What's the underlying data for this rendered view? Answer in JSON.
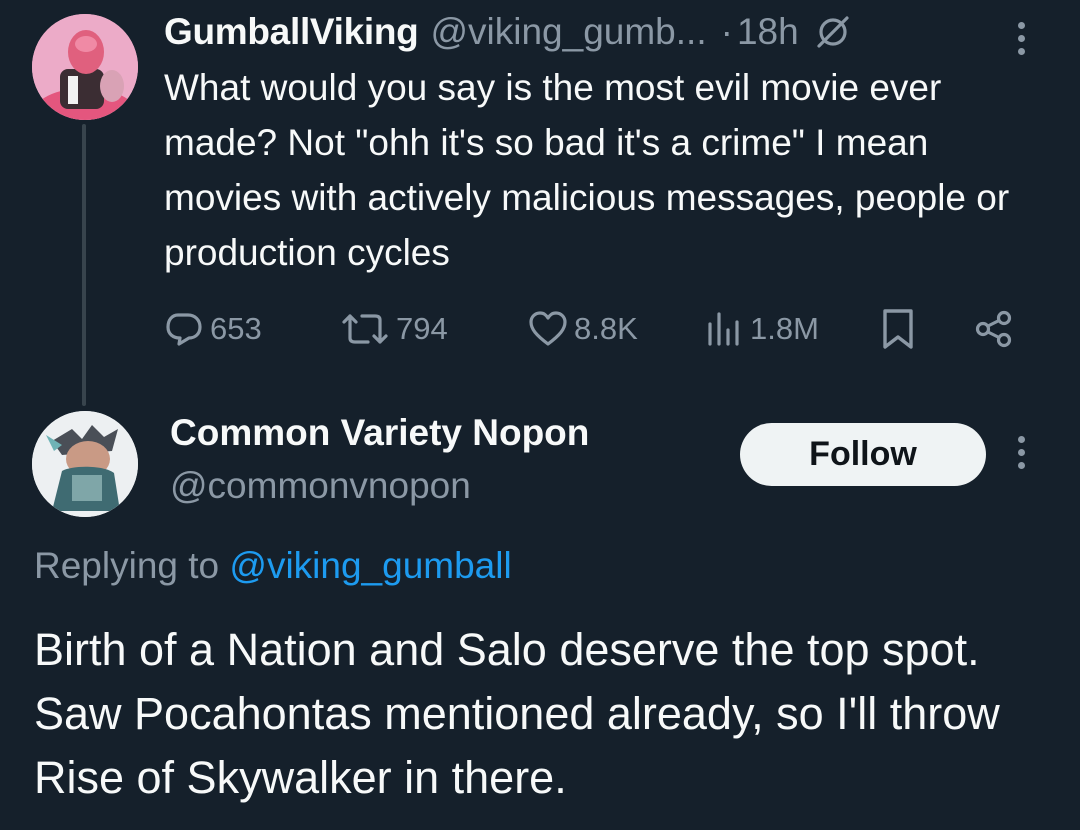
{
  "parent_tweet": {
    "display_name": "GumballViking",
    "handle": "@viking_gumb...",
    "separator": "·",
    "time": "18h",
    "text": "What would you say is the most evil movie ever made? Not \"ohh it's so bad it's a crime\" I mean movies with actively malicious messages, people or production cycles",
    "actions": {
      "replies": "653",
      "reposts": "794",
      "likes": "8.8K",
      "views": "1.8M"
    },
    "icons": [
      "muted-icon",
      "more-icon",
      "reply-icon",
      "repost-icon",
      "like-icon",
      "views-icon",
      "bookmark-icon",
      "share-icon"
    ]
  },
  "reply_tweet": {
    "display_name": "Common Variety Nopon",
    "handle": "@commonvnopon",
    "follow_label": "Follow",
    "replying_to_prefix": "Replying to ",
    "replying_to_mention": "@viking_gumball",
    "text": "Birth of a Nation and Salo deserve the top spot. Saw Pocahontas mentioned already, so I'll throw Rise of Skywalker in there."
  },
  "colors": {
    "background": "#15202b",
    "text_primary": "#f7f9f9",
    "text_secondary": "#8b98a5",
    "link": "#1d9bf0",
    "follow_button_bg": "#eff3f4"
  }
}
